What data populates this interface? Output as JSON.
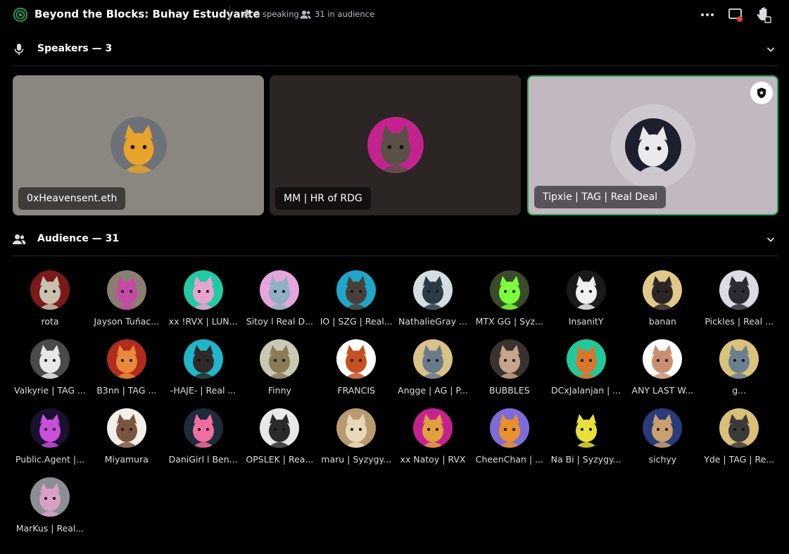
{
  "header": {
    "title": "Beyond the Blocks: Buhay Estudyante",
    "speaking": "3 speaking",
    "audience_count": "31 in audience"
  },
  "speakers_section": {
    "label": "Speakers — 3"
  },
  "audience_section": {
    "label": "Audience — 31"
  },
  "speakers": [
    {
      "name": "0xHeavensent.eth",
      "bg": "#8a8780",
      "avatar_bg": "#6e7177",
      "accent": "#e8a32a",
      "active": false
    },
    {
      "name": "MM | HR of RDG",
      "bg": "#2b2523",
      "avatar_bg": "#c4238f",
      "accent": "#5b5048",
      "active": false
    },
    {
      "name": "Tipxie | TAG | Real Deal",
      "bg": "#c2b8c0",
      "avatar_bg": "#1d1f2e",
      "accent": "#e9e9ec",
      "active": true
    }
  ],
  "audience": [
    {
      "name": "rota",
      "bg": "#7a1a1a",
      "fg": "#c9c0b0"
    },
    {
      "name": "Jayson Tuñac...",
      "bg": "#8a7f6e",
      "fg": "#c64aa4"
    },
    {
      "name": "ⅹⅹ !RVX | LUN...",
      "bg": "#22c9a5",
      "fg": "#e6a4cf"
    },
    {
      "name": "Sitoy l Real D...",
      "bg": "#e6a5dc",
      "fg": "#8fb0c0"
    },
    {
      "name": "IO | SZG | Real...",
      "bg": "#1fa7c9",
      "fg": "#4a3f38"
    },
    {
      "name": "NathalieGray ...",
      "bg": "#d4dde0",
      "fg": "#2d3a45"
    },
    {
      "name": "MTX GG | Syz...",
      "bg": "#3a4a2a",
      "fg": "#7cff3c"
    },
    {
      "name": "InsanitY",
      "bg": "#1a1a1a",
      "fg": "#f0f0f0"
    },
    {
      "name": "banan",
      "bg": "#e0c888",
      "fg": "#2b2525"
    },
    {
      "name": "Pickles | Real ...",
      "bg": "#d9dce4",
      "fg": "#2b2b33"
    },
    {
      "name": "Valkyrie | TAG ...",
      "bg": "#4a4a4a",
      "fg": "#e8e8e8"
    },
    {
      "name": "B3nn | TAG ...",
      "bg": "#b02c1e",
      "fg": "#e88a3a"
    },
    {
      "name": "-HAJE- | Real ...",
      "bg": "#1fb6c9",
      "fg": "#2f2a28"
    },
    {
      "name": "Finny",
      "bg": "#c8c8b4",
      "fg": "#8a7a55"
    },
    {
      "name": "FRANCIS",
      "bg": "#ffffff",
      "fg": "#c65020"
    },
    {
      "name": "Angge | AG | P...",
      "bg": "#d9c18a",
      "fg": "#6b7a8a"
    },
    {
      "name": "BUBBLES",
      "bg": "#3a3230",
      "fg": "#c7a58a"
    },
    {
      "name": "DCxJalanjan | ...",
      "bg": "#1fc99a",
      "fg": "#d9762e"
    },
    {
      "name": "ANY LAST W...",
      "bg": "#ffffff",
      "fg": "#c89070"
    },
    {
      "name": "g...",
      "bg": "#d9c27a",
      "fg": "#6b7f8f"
    },
    {
      "name": "Public.Agent |...",
      "bg": "#1a1030",
      "fg": "#c94fd9"
    },
    {
      "name": "Miyamura",
      "bg": "#f3efe8",
      "fg": "#7a5540"
    },
    {
      "name": "DaniGirl l Ben...",
      "bg": "#1d2b3a",
      "fg": "#f06ea0"
    },
    {
      "name": "OPSLEK | Rea...",
      "bg": "#e8e8e8",
      "fg": "#2a2a2a"
    },
    {
      "name": "maru | Syzygy...",
      "bg": "#b89a70",
      "fg": "#e8d8b8"
    },
    {
      "name": "ⅹⅹ Natoy | RVX",
      "bg": "#c4238f",
      "fg": "#e0a040"
    },
    {
      "name": "CheenChan | ...",
      "bg": "#7f6ad9",
      "fg": "#e8902a"
    },
    {
      "name": "Na Bi | Syzygy...",
      "bg": "#000000",
      "fg": "#e8e03c"
    },
    {
      "name": "sichyy",
      "bg": "#2a3a7a",
      "fg": "#c9a070"
    },
    {
      "name": "Yde | TAG | Re...",
      "bg": "#d9c07a",
      "fg": "#3a3a3a"
    },
    {
      "name": "MarKus | Real...",
      "bg": "#8a8f96",
      "fg": "#d9a0c4"
    }
  ]
}
